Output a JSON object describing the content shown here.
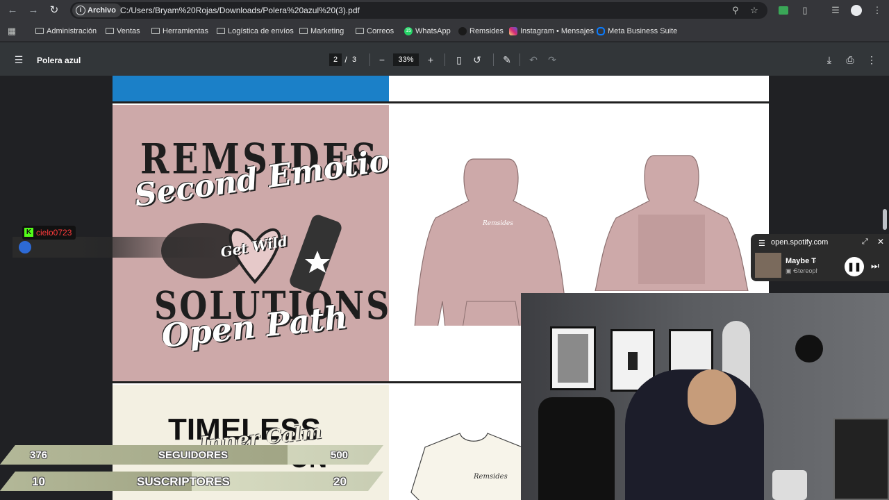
{
  "browser": {
    "file_chip": "Archivo",
    "url": "C:/Users/Bryam%20Rojas/Downloads/Polera%20azul%20(3).pdf"
  },
  "bookmarks": [
    {
      "label": "Administración",
      "icon": "folder-icon"
    },
    {
      "label": "Ventas",
      "icon": "folder-icon"
    },
    {
      "label": "Herramientas",
      "icon": "folder-icon"
    },
    {
      "label": "Logística de envíos",
      "icon": "folder-icon"
    },
    {
      "label": "Marketing",
      "icon": "folder-icon"
    },
    {
      "label": "Correos",
      "icon": "folder-icon"
    },
    {
      "label": "WhatsApp",
      "icon": "whatsapp-icon",
      "badge": "15"
    },
    {
      "label": "Remsides",
      "icon": "remsides-icon"
    },
    {
      "label": "Instagram • Mensajes",
      "icon": "instagram-icon"
    },
    {
      "label": "Meta Business Suite",
      "icon": "meta-icon"
    }
  ],
  "pdf": {
    "title": "Polera azul",
    "current_page": "2",
    "page_sep": "/",
    "total_pages": "3",
    "zoom": "33%"
  },
  "artwork": {
    "top_words": "REMSIDES",
    "script_1": "Second Emotion",
    "heart_script": "Get Wild",
    "bottom_words": "SOLUTIONS",
    "script_2": "Open Path",
    "hoodie_chest_logo": "Remsides",
    "timeless_headline": "TIMELESS",
    "timeless_script": "Inner Calm",
    "timeless_line2": "ON",
    "tee_logo": "Remsides"
  },
  "chat": {
    "username": "cielo0723"
  },
  "spotify": {
    "domain": "open.spotify.com",
    "title": "Maybe Tom",
    "artist": "Stereoph"
  },
  "goals": [
    {
      "current": "376",
      "label": "SEGUIDORES",
      "target": "500",
      "progress": 0.75
    },
    {
      "current": "10",
      "label": "SUSCRIPTORES",
      "target": "20",
      "progress": 0.5
    }
  ],
  "colors": {
    "pdf_blue": "#1b80c8",
    "hoodie_pink": "#cda9a9",
    "chat_user": "#ff3b3b",
    "kick_green": "#53fc18"
  }
}
